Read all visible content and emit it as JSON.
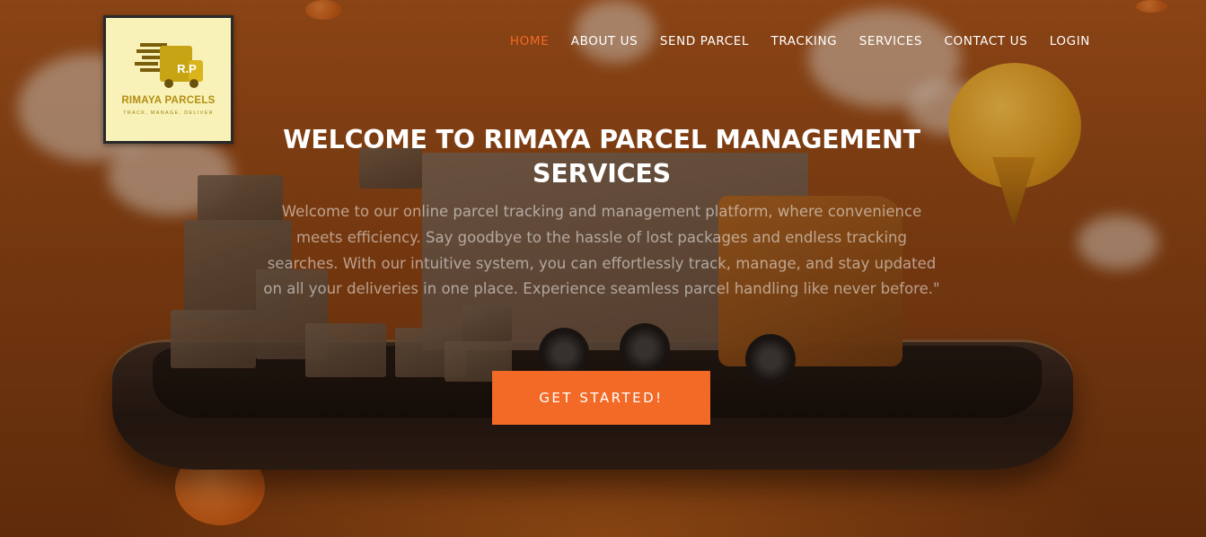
{
  "logo": {
    "monogram": "R.P",
    "name": "RIMAYA PARCELS",
    "tagline": "TRACK. MANAGE. DELIVER"
  },
  "nav": {
    "items": [
      {
        "label": "HOME",
        "active": true
      },
      {
        "label": "ABOUT US",
        "active": false
      },
      {
        "label": "SEND PARCEL",
        "active": false
      },
      {
        "label": "TRACKING",
        "active": false
      },
      {
        "label": "SERVICES",
        "active": false
      },
      {
        "label": "CONTACT US",
        "active": false
      },
      {
        "label": "LOGIN",
        "active": false
      }
    ]
  },
  "hero": {
    "title": "WELCOME TO RIMAYA PARCEL MANAGEMENT SERVICES",
    "description": "Welcome to our online parcel tracking and management platform, where convenience meets efficiency. Say goodbye to the hassle of lost packages and endless tracking searches. With our intuitive system, you can effortlessly track, manage, and stay updated on all your deliveries in one place. Experience seamless parcel handling like never before.\"",
    "cta_label": "GET STARTED!"
  },
  "colors": {
    "accent": "#f26a26",
    "logo_bg": "#f8f1b8",
    "logo_gold": "#b28e12"
  }
}
